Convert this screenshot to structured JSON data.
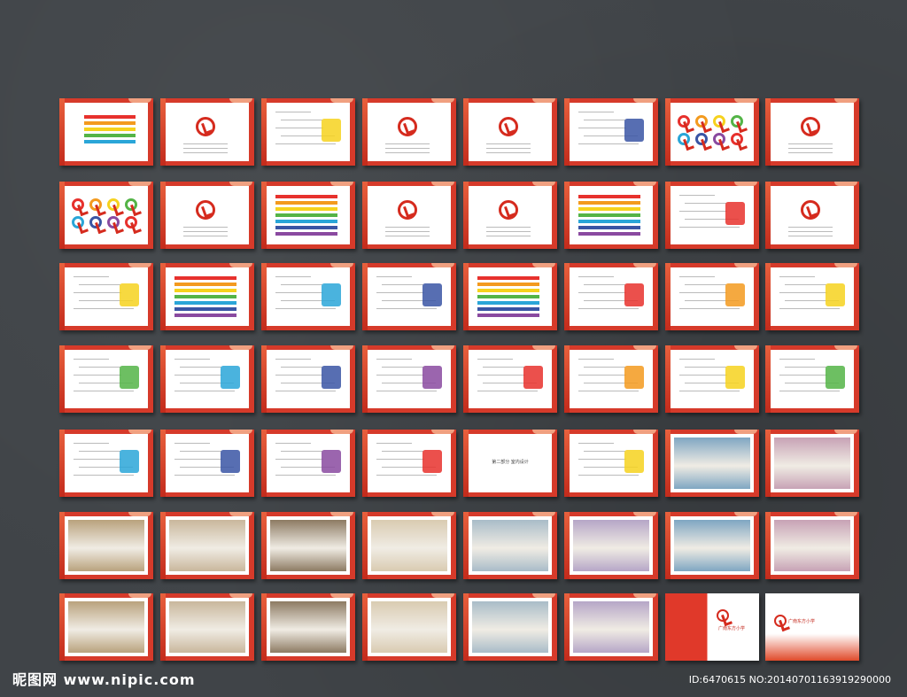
{
  "watermark_left": "昵图网 www.nipic.com",
  "watermark_right": "ID:6470615 NO:20140701163919290000",
  "section_title": "第二部分   室内设计",
  "school_name": "广南东方小学",
  "colors": {
    "background": "#404448",
    "frame": "#d63a2a",
    "accent": "#d52b1e"
  },
  "rows": 7,
  "cols": 8
}
